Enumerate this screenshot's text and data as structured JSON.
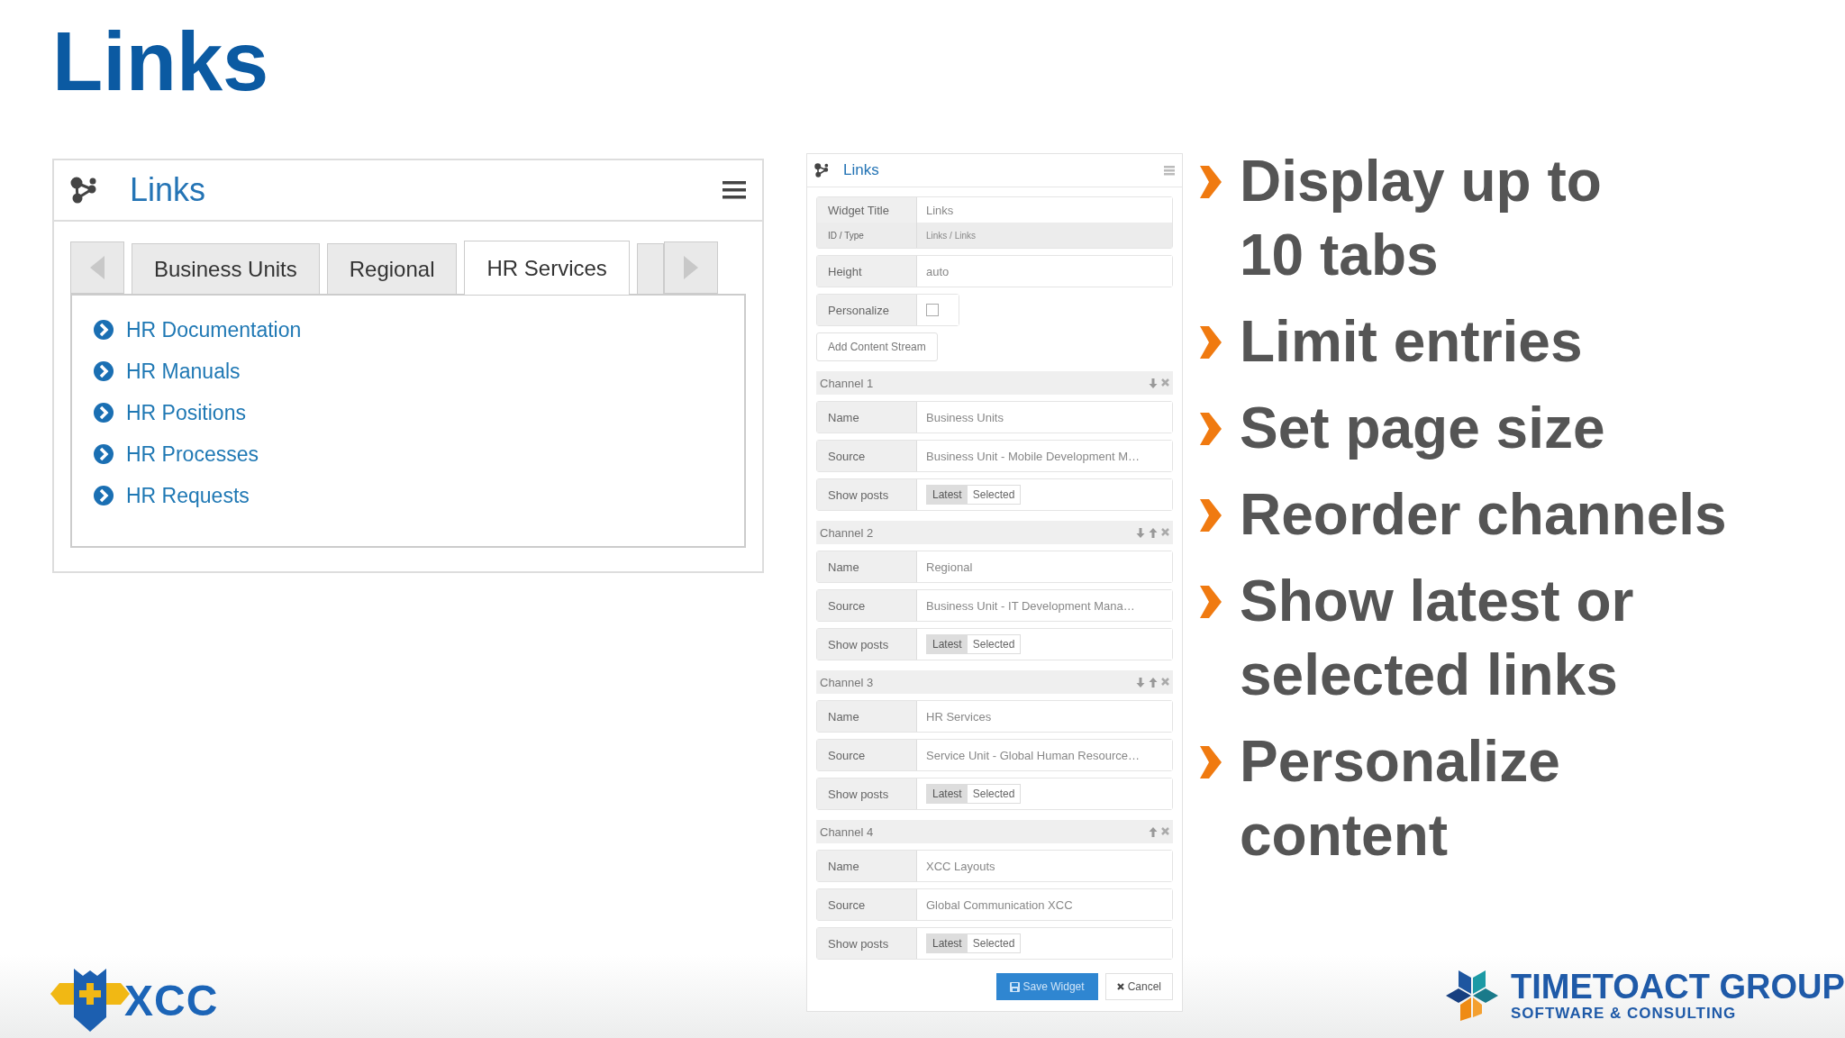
{
  "slide_title": "Links",
  "widget": {
    "title": "Links",
    "tabs": [
      {
        "label": "Business Units",
        "selected": false
      },
      {
        "label": "Regional",
        "selected": false
      },
      {
        "label": "HR Services",
        "selected": true
      }
    ],
    "links": [
      "HR Documentation",
      "HR Manuals",
      "HR Positions",
      "HR Processes",
      "HR Requests"
    ]
  },
  "settings": {
    "title": "Links",
    "general": [
      {
        "kind": "double",
        "label": "Widget Title",
        "value": "Links",
        "sub_label": "ID / Type",
        "sub_value": "Links / Links"
      },
      {
        "kind": "text",
        "label": "Height",
        "value": "auto"
      },
      {
        "kind": "checkbox",
        "label": "Personalize",
        "checked": false
      }
    ],
    "add_button": "Add Content Stream",
    "channels": [
      {
        "title": "Channel 1",
        "actions": [
          {
            "kind": "down"
          },
          {
            "kind": "remove"
          }
        ],
        "name_label": "Name",
        "name": "Business Units",
        "source_label": "Source",
        "source": "Business Unit - Mobile Development M…",
        "posts_label": "Show posts",
        "options": [
          {
            "label": "Latest",
            "selected": true
          },
          {
            "label": "Selected",
            "selected": false
          }
        ]
      },
      {
        "title": "Channel 2",
        "actions": [
          {
            "kind": "down"
          },
          {
            "kind": "up"
          },
          {
            "kind": "remove"
          }
        ],
        "name_label": "Name",
        "name": "Regional",
        "source_label": "Source",
        "source": "Business Unit - IT Development Mana…",
        "posts_label": "Show posts",
        "options": [
          {
            "label": "Latest",
            "selected": true
          },
          {
            "label": "Selected",
            "selected": false
          }
        ]
      },
      {
        "title": "Channel 3",
        "actions": [
          {
            "kind": "down"
          },
          {
            "kind": "up"
          },
          {
            "kind": "remove"
          }
        ],
        "name_label": "Name",
        "name": "HR Services",
        "source_label": "Source",
        "source": "Service Unit - Global Human Resource…",
        "posts_label": "Show posts",
        "options": [
          {
            "label": "Latest",
            "selected": true
          },
          {
            "label": "Selected",
            "selected": false
          }
        ]
      },
      {
        "title": "Channel 4",
        "actions": [
          {
            "kind": "up"
          },
          {
            "kind": "remove"
          }
        ],
        "name_label": "Name",
        "name": "XCC Layouts",
        "source_label": "Source",
        "source": "Global Communication XCC",
        "posts_label": "Show posts",
        "options": [
          {
            "label": "Latest",
            "selected": true
          },
          {
            "label": "Selected",
            "selected": false
          }
        ]
      }
    ],
    "buttons": [
      {
        "kind": "primary",
        "label": "Save Widget"
      },
      {
        "kind": "secondary",
        "label": "Cancel"
      }
    ]
  },
  "bullets": [
    {
      "lines": [
        "Display up to",
        "10 tabs"
      ]
    },
    {
      "lines": [
        "Limit entries"
      ]
    },
    {
      "lines": [
        "Set page size"
      ]
    },
    {
      "lines": [
        "Reorder channels"
      ]
    },
    {
      "lines": [
        "Show latest or",
        "selected links"
      ]
    },
    {
      "lines": [
        "Personalize",
        "content"
      ]
    }
  ],
  "logos": {
    "left_text": "XCC",
    "right_title": "TIMETOACT GROUP",
    "right_subtitle": "SOFTWARE & CONSULTING"
  }
}
